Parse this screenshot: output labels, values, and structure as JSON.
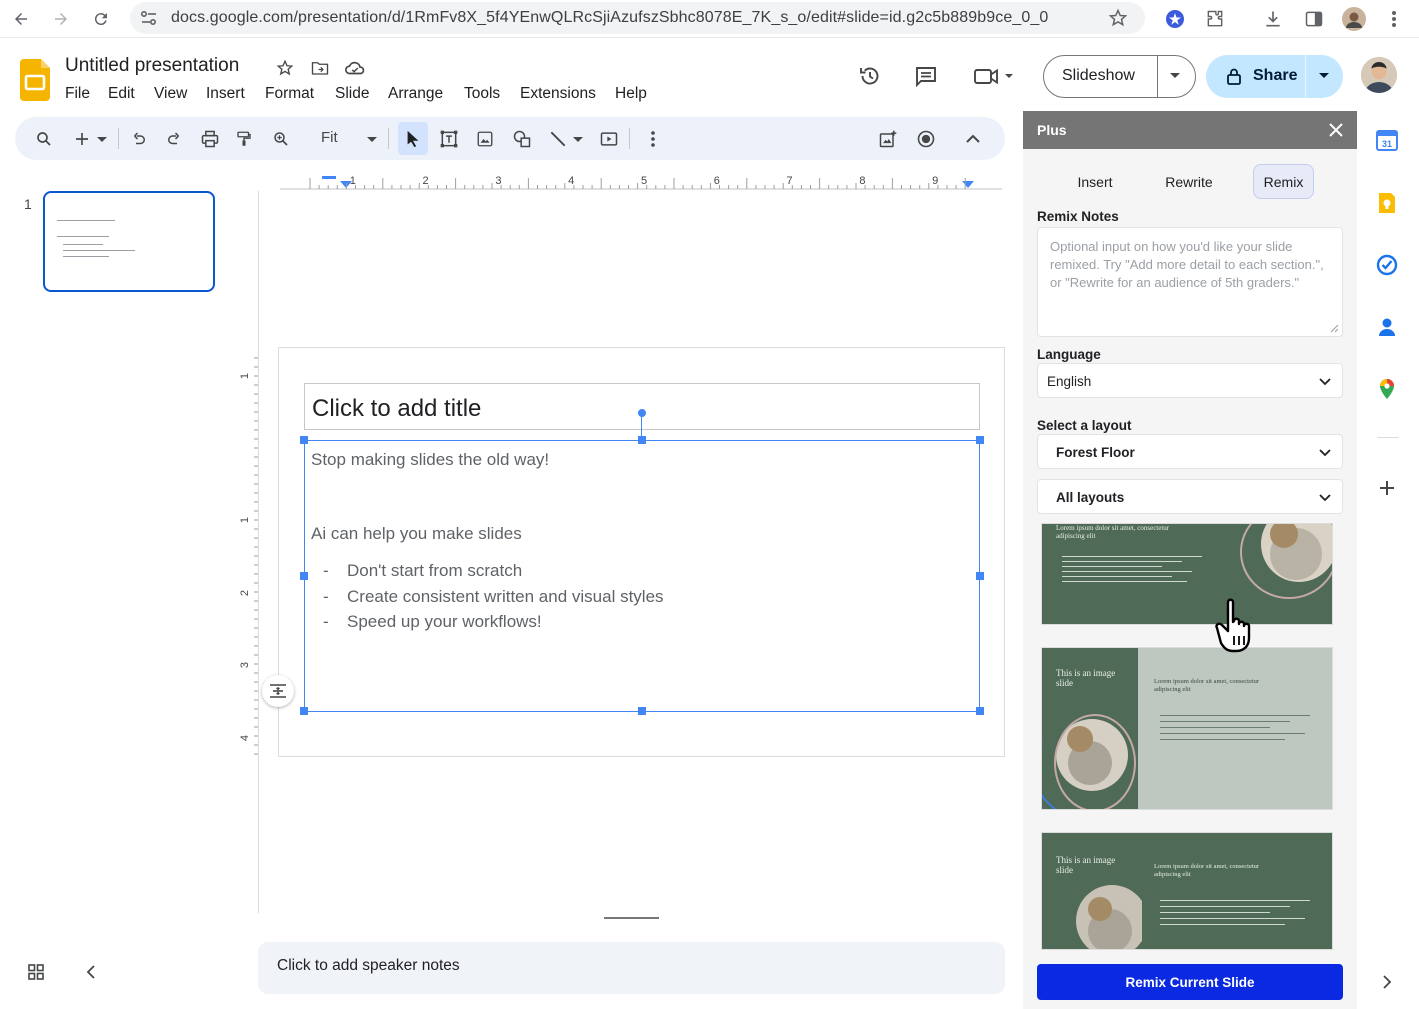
{
  "browser": {
    "url": "docs.google.com/presentation/d/1RmFv8X_5f4YEnwQLRcSjiAzufszSbhc8078E_7K_s_o/edit#slide=id.g2c5b889b9ce_0_0"
  },
  "app": {
    "title": "Untitled presentation",
    "menu": [
      "File",
      "Edit",
      "View",
      "Insert",
      "Format",
      "Slide",
      "Arrange",
      "Tools",
      "Extensions",
      "Help"
    ],
    "slideshow_label": "Slideshow",
    "share_label": "Share"
  },
  "toolbar": {
    "zoom": "Fit"
  },
  "filmstrip": {
    "slide_number": "1"
  },
  "ruler": {
    "h_ticks": [
      "1",
      "2",
      "3",
      "4",
      "5",
      "6",
      "7",
      "8",
      "9"
    ],
    "v_ticks": [
      "1",
      "1",
      "2",
      "3",
      "4"
    ]
  },
  "slide": {
    "title_placeholder": "Click to add title",
    "body": {
      "line1": "Stop making slides the old way!",
      "line2": "Ai can help you make slides",
      "bullets": [
        "Don't start from scratch",
        "Create consistent written and visual styles",
        "Speed up your workflows!"
      ],
      "bullet_marker": "-"
    }
  },
  "notes": {
    "placeholder": "Click to add speaker notes"
  },
  "panel": {
    "title": "Plus",
    "tabs": [
      "Insert",
      "Rewrite",
      "Remix"
    ],
    "active_tab": "Remix",
    "remix_notes_label": "Remix Notes",
    "remix_notes_placeholder": "Optional input on how you'd like your slide remixed. Try \"Add more detail to each section.\", or \"Rewrite for an audience of 5th graders.\"",
    "language_label": "Language",
    "language_value": "English",
    "layout_label": "Select a layout",
    "layout_value": "Forest Floor",
    "layout_filter": "All layouts",
    "cards": [
      {
        "heading": "",
        "subheading": "Lorem ipsum dolor sit amet, consectetur adipiscing elit"
      },
      {
        "heading": "This is an image slide",
        "subheading": "Lorem ipsum dolor sit amet, consectetur adipiscing elit"
      },
      {
        "heading": "This is an image slide",
        "subheading": "Lorem ipsum dolor sit amet, consectetur adipiscing elit"
      }
    ],
    "remix_button": "Remix Current Slide"
  },
  "colors": {
    "accent_blue": "#0b57d0",
    "share_bg": "#c2e7ff",
    "toolbar_bg": "#edf2fa",
    "panel_header": "#757575",
    "remix_button": "#0b29e0",
    "layout_green": "#4f6a57",
    "layout_gray": "#bfc8c0"
  }
}
